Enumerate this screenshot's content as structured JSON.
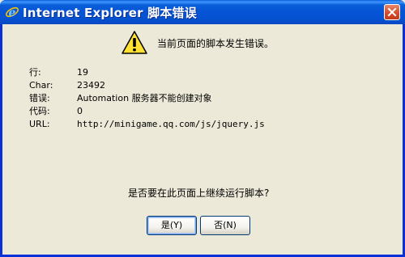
{
  "window": {
    "title": "Internet Explorer 脚本错误",
    "title_bar_color": "#0553d6",
    "icons": {
      "app": "ie-icon",
      "close": "close-icon",
      "warning": "warning-icon"
    }
  },
  "message": {
    "headline": "当前页面的脚本发生错误。"
  },
  "details": [
    {
      "label": "行:",
      "value": "19"
    },
    {
      "label": "Char:",
      "value": "23492"
    },
    {
      "label": "错误:",
      "value": "Automation 服务器不能创建对象"
    },
    {
      "label": "代码:",
      "value": "0"
    },
    {
      "label": "URL:",
      "value": "http://minigame.qq.com/js/jquery.js"
    }
  ],
  "prompt": "是否要在此页面上继续运行脚本?",
  "buttons": {
    "yes": "是(Y)",
    "no": "否(N)"
  }
}
